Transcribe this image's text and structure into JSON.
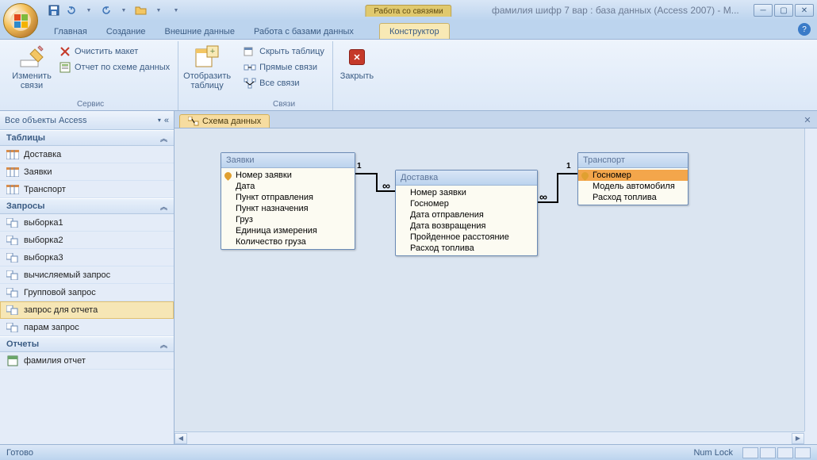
{
  "window": {
    "title": "фамилия шифр 7 вар : база данных (Access 2007) - M...",
    "context_label": "Работа со связями"
  },
  "tabs": {
    "items": [
      "Главная",
      "Создание",
      "Внешние данные",
      "Работа с базами данных"
    ],
    "context": "Конструктор"
  },
  "ribbon": {
    "group1": {
      "label": "Сервис",
      "big": "Изменить связи",
      "s1": "Очистить макет",
      "s2": "Отчет по схеме данных"
    },
    "group2": {
      "big": "Отобразить таблицу"
    },
    "group3": {
      "label": "Связи",
      "s1": "Скрыть таблицу",
      "s2": "Прямые связи",
      "s3": "Все связи"
    },
    "group4": {
      "big": "Закрыть"
    }
  },
  "sidebar": {
    "title": "Все объекты Access",
    "cat_tables": "Таблицы",
    "tables": [
      "Доставка",
      "Заявки",
      "Транспорт"
    ],
    "cat_queries": "Запросы",
    "queries": [
      "выборка1",
      "выборка2",
      "выборка3",
      "вычисляемый запрос",
      "Групповой запрос",
      "запрос для отчета",
      "парам запрос"
    ],
    "cat_reports": "Отчеты",
    "reports": [
      "фамилия отчет"
    ]
  },
  "doc_tab": "Схема данных",
  "tables": {
    "t1": {
      "title": "Заявки",
      "fields": [
        "Номер заявки",
        "Дата",
        "Пункт отправления",
        "Пункт назначения",
        "Груз",
        "Единица измерения",
        "Количество груза"
      ]
    },
    "t2": {
      "title": "Доставка",
      "fields": [
        "Номер заявки",
        "Госномер",
        "Дата отправления",
        "Дата возвращения",
        "Пройденное расстояние",
        "Расход топлива"
      ]
    },
    "t3": {
      "title": "Транспорт",
      "fields": [
        "Госномер",
        "Модель автомобиля",
        "Расход топлива"
      ]
    }
  },
  "rel": {
    "one": "1",
    "many": "∞"
  },
  "statusbar": {
    "left": "Готово",
    "numlock": "Num Lock"
  }
}
